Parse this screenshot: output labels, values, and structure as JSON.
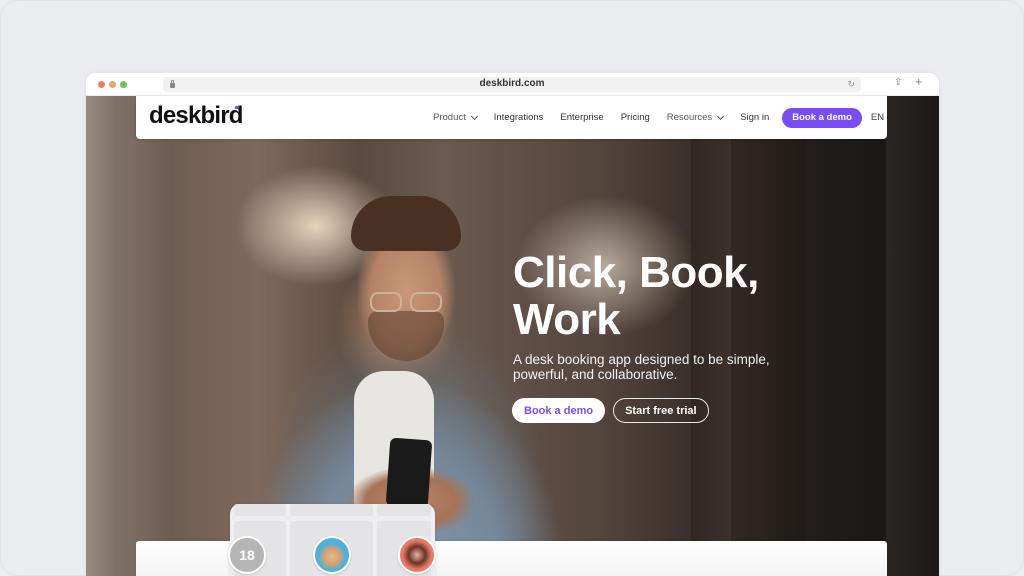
{
  "browser": {
    "url": "deskbird.com",
    "icons": {
      "lock": "lock-icon",
      "reload": "reload-icon",
      "share": "share-icon",
      "new_tab": "plus-icon"
    },
    "reload_glyph": "↻",
    "share_glyph": "⇪",
    "plus_glyph": "+"
  },
  "navbar": {
    "logo": "deskbird",
    "items": [
      {
        "label": "Product",
        "has_dropdown": true
      },
      {
        "label": "Integrations",
        "has_dropdown": false
      },
      {
        "label": "Enterprise",
        "has_dropdown": false
      },
      {
        "label": "Pricing",
        "has_dropdown": false
      },
      {
        "label": "Resources",
        "has_dropdown": true
      },
      {
        "label": "Sign in",
        "has_dropdown": false
      }
    ],
    "cta_label": "Book a demo",
    "language": "EN"
  },
  "hero": {
    "title": "Click, Book, Work",
    "subtitle": "A desk booking app designed to be simple, powerful, and collaborative.",
    "primary_button": "Book a demo",
    "secondary_button": "Start free trial"
  },
  "booking_preview": {
    "count_badge": "18"
  },
  "colors": {
    "brand": "#7a4cf5",
    "traffic_red": "#e0826a",
    "traffic_yellow": "#e2a86d",
    "traffic_green": "#6cc35b"
  }
}
